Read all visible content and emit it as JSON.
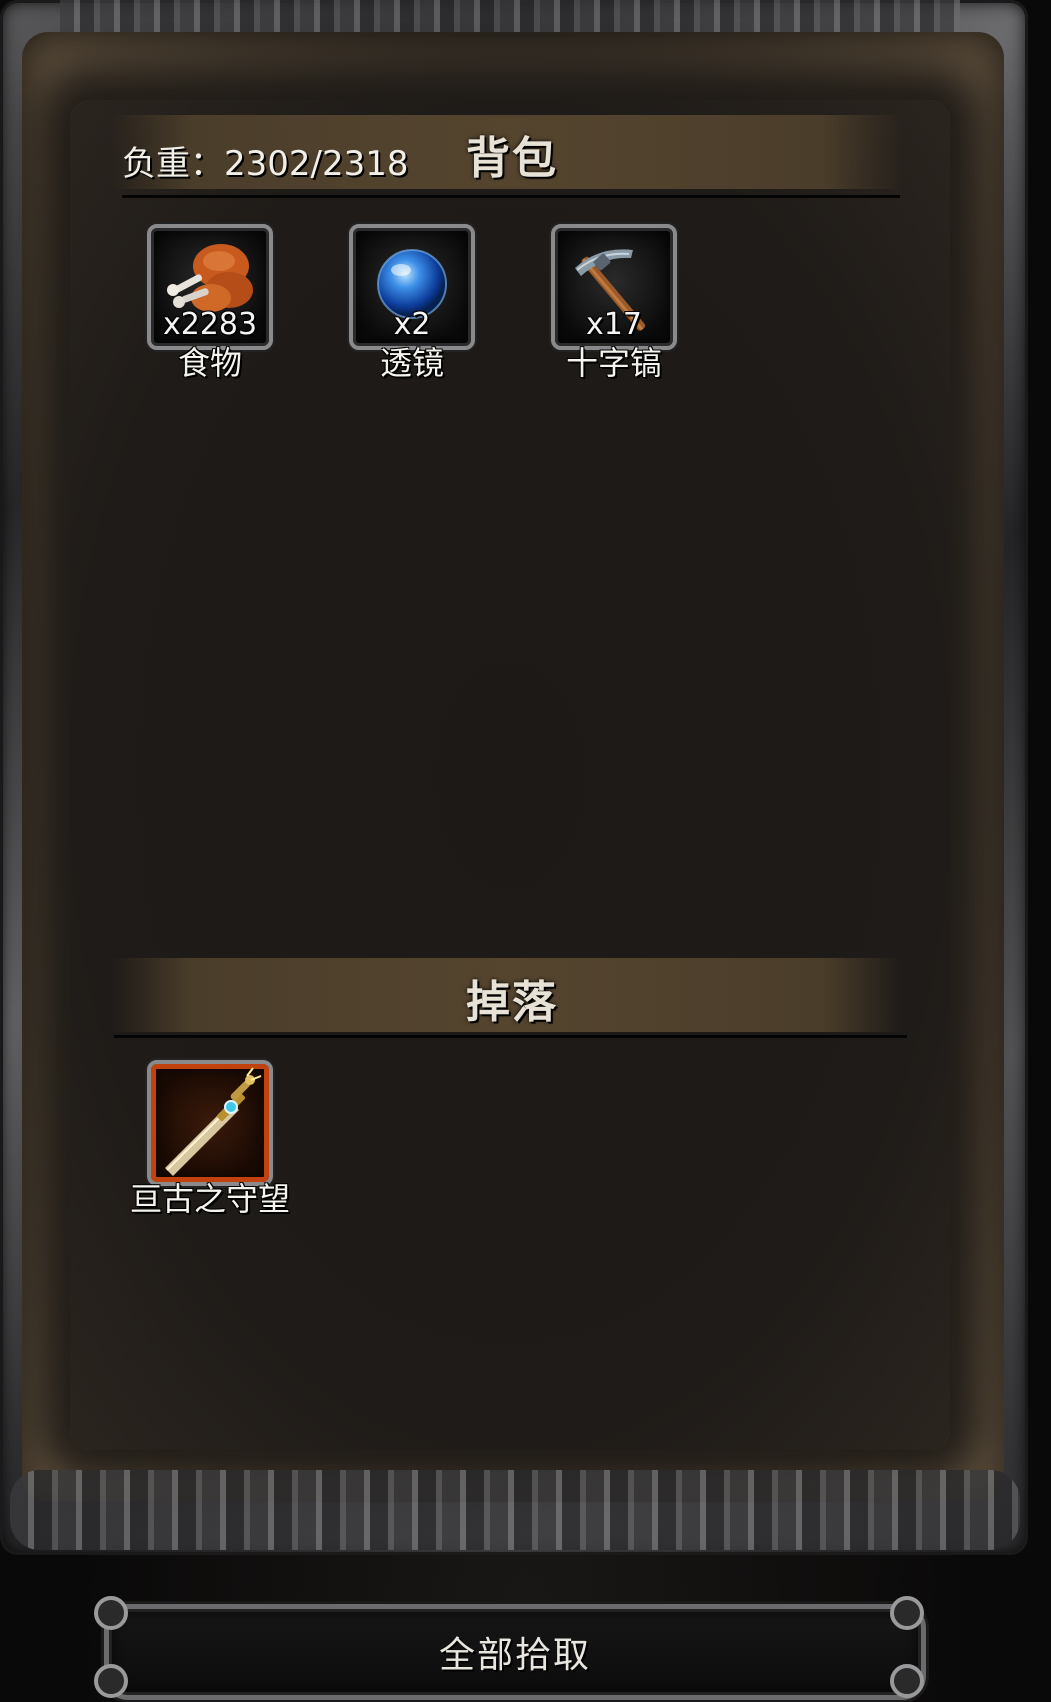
{
  "backpack": {
    "title": "背包",
    "weight_label": "负重：2302/2318",
    "items": [
      {
        "name": "食物",
        "qty": "x2283",
        "icon": "chicken-leg-icon"
      },
      {
        "name": "透镜",
        "qty": "x2",
        "icon": "blue-orb-lens-icon"
      },
      {
        "name": "十字镐",
        "qty": "x17",
        "icon": "pickaxe-icon"
      }
    ]
  },
  "drops": {
    "title": "掉落",
    "items": [
      {
        "name": "亘古之守望",
        "qty": "",
        "icon": "sword-icon",
        "rarity_color": "#c2410c"
      }
    ]
  },
  "actions": {
    "pickup_all_label": "全部拾取"
  },
  "colors": {
    "header_bar": "#55452f",
    "panel_bg": "#1f1b18",
    "rare_border": "#c2410c",
    "text": "#f5f3ee"
  }
}
